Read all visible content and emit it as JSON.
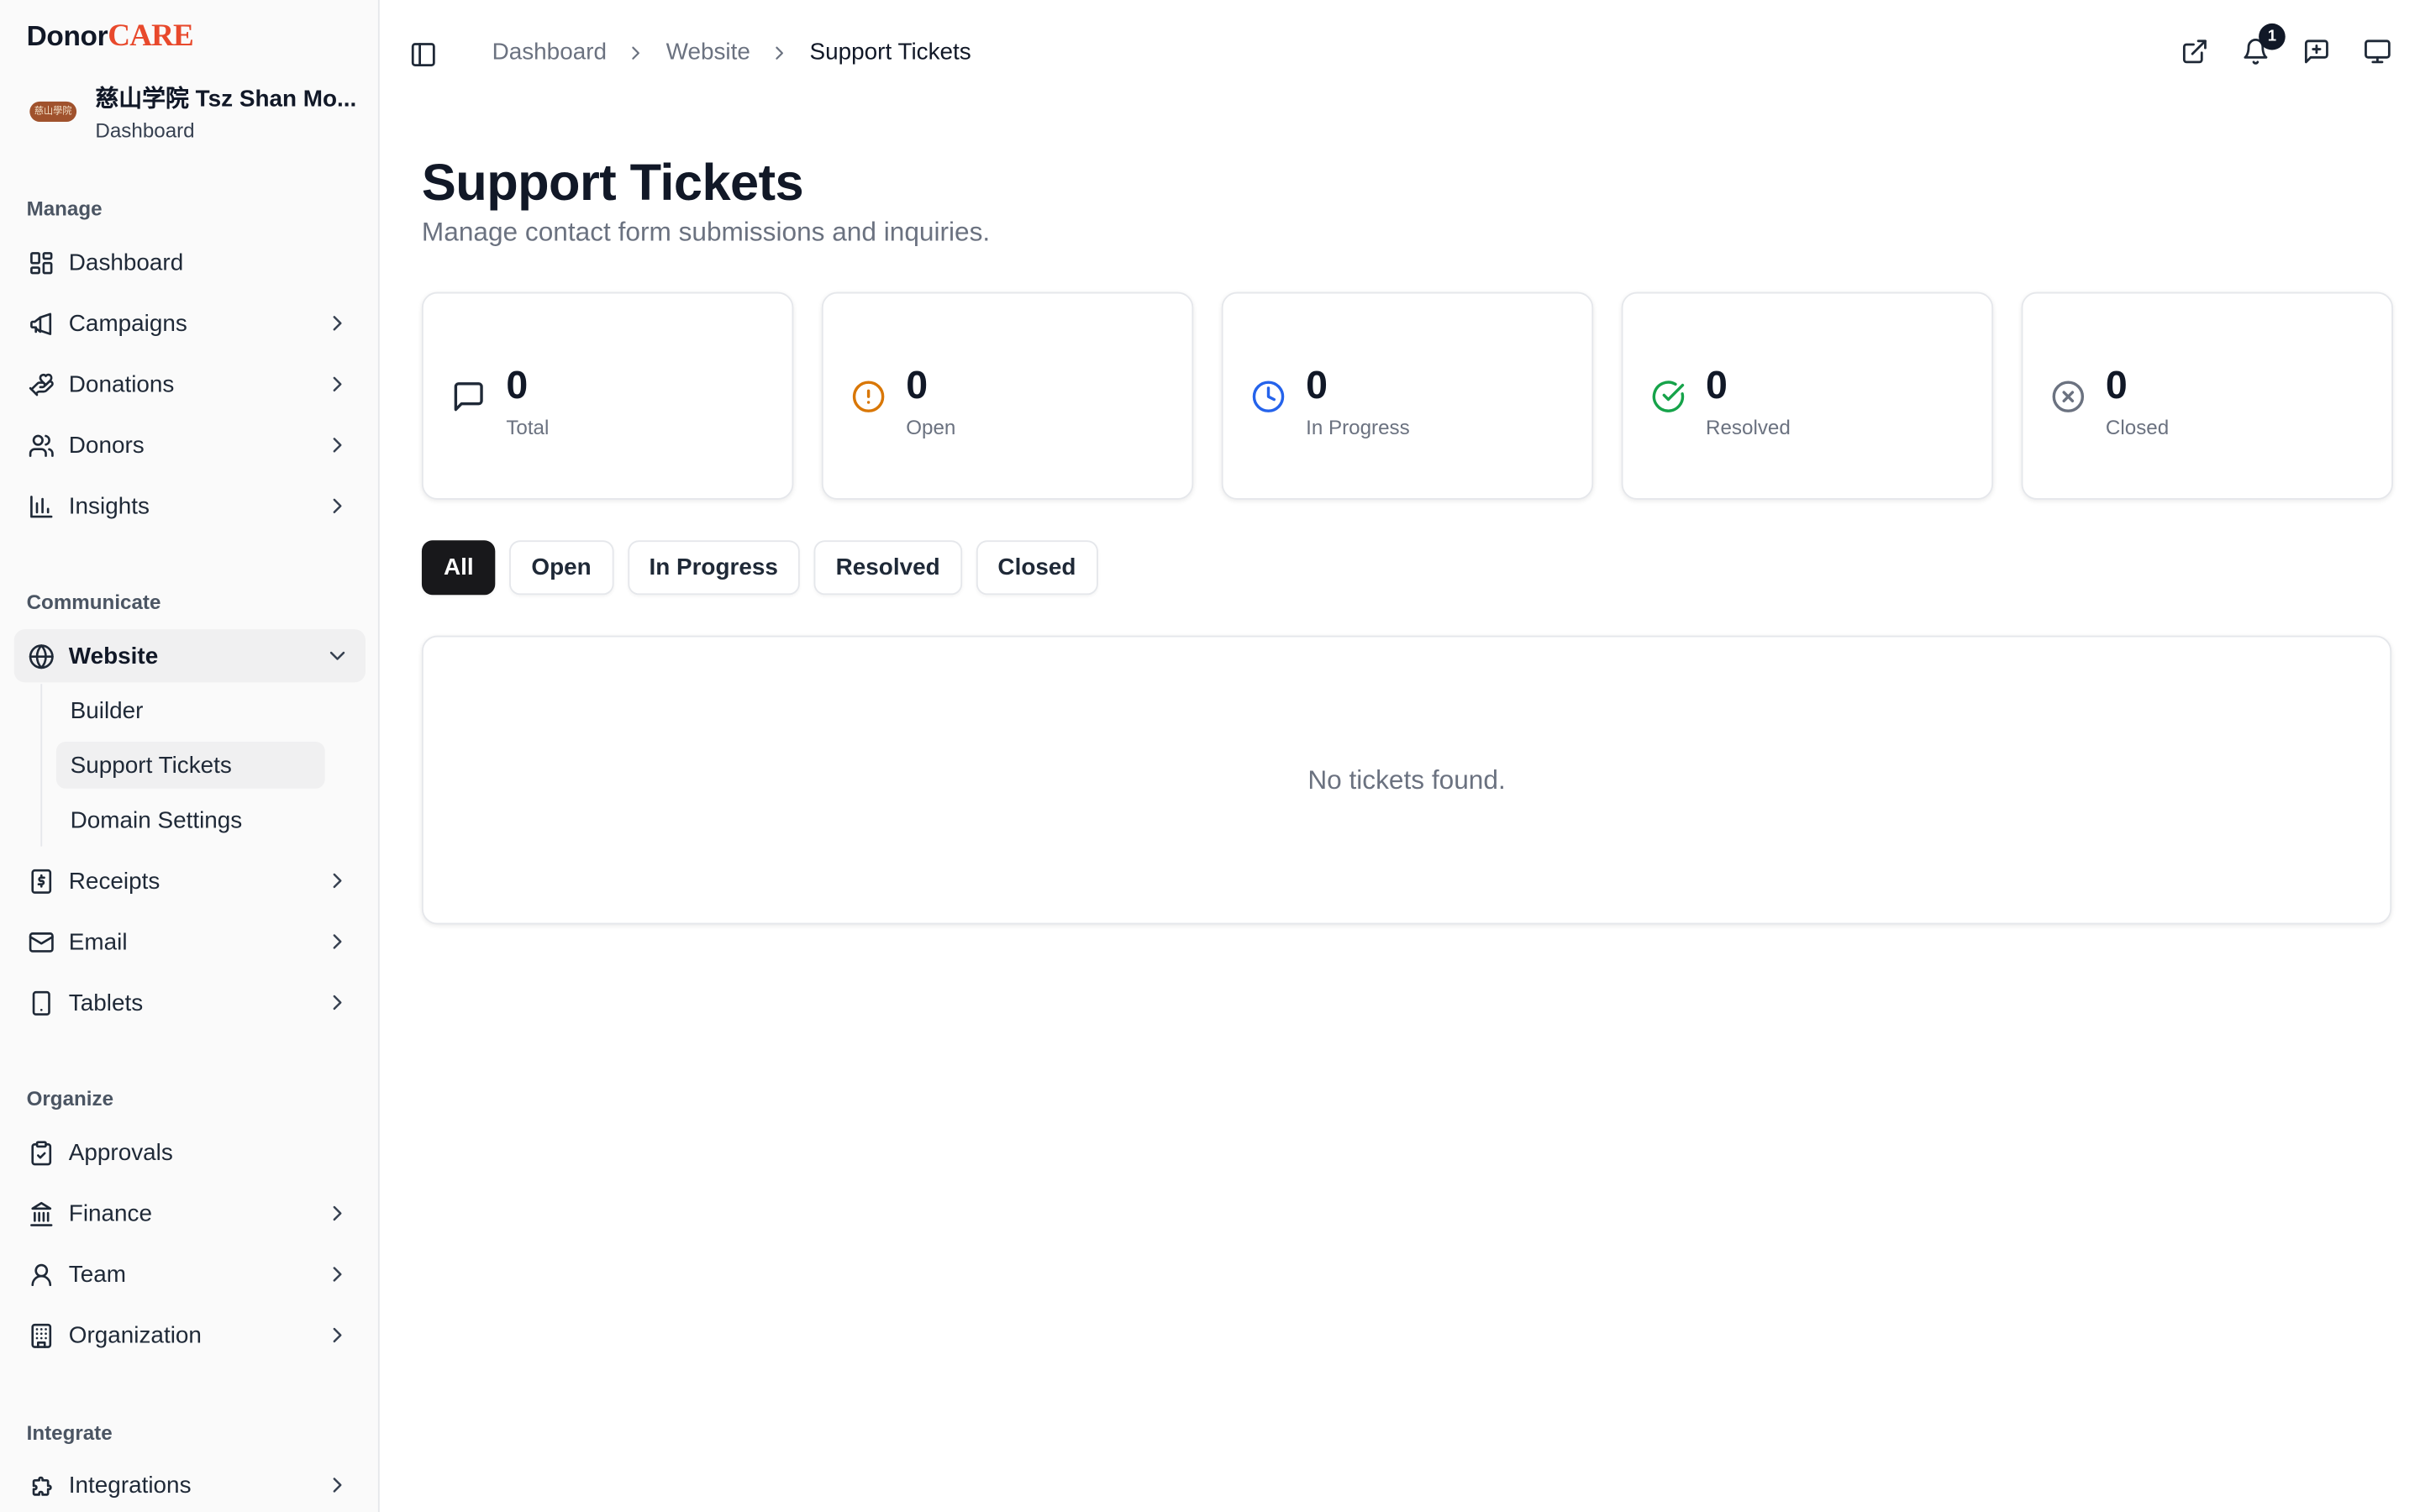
{
  "brand": {
    "part1": "Donor",
    "part2": "CARE"
  },
  "org": {
    "name": "慈山学院 Tsz Shan Mo...",
    "subtitle": "Dashboard",
    "avatar_text": "慈山學院"
  },
  "sidebar": {
    "sections": [
      "Manage",
      "Communicate",
      "Organize",
      "Integrate"
    ],
    "items": [
      {
        "label": "Dashboard",
        "icon": "layout-grid-icon"
      },
      {
        "label": "Campaigns",
        "icon": "megaphone-icon"
      },
      {
        "label": "Donations",
        "icon": "hand-heart-icon"
      },
      {
        "label": "Donors",
        "icon": "users-icon"
      },
      {
        "label": "Insights",
        "icon": "bar-chart-icon"
      },
      {
        "label": "Website",
        "icon": "globe-icon"
      },
      {
        "label": "Receipts",
        "icon": "receipt-dollar-icon"
      },
      {
        "label": "Email",
        "icon": "mail-icon"
      },
      {
        "label": "Tablets",
        "icon": "tablet-icon"
      },
      {
        "label": "Approvals",
        "icon": "clipboard-check-icon"
      },
      {
        "label": "Finance",
        "icon": "landmark-icon"
      },
      {
        "label": "Team",
        "icon": "user-icon"
      },
      {
        "label": "Organization",
        "icon": "building-icon"
      },
      {
        "label": "Integrations",
        "icon": "puzzle-icon"
      }
    ],
    "website_sub": [
      "Builder",
      "Support Tickets",
      "Domain Settings"
    ]
  },
  "breadcrumb": [
    "Dashboard",
    "Website",
    "Support Tickets"
  ],
  "header": {
    "notification_count": "1"
  },
  "page": {
    "title": "Support Tickets",
    "subtitle": "Manage contact form submissions and inquiries."
  },
  "stats": [
    {
      "value": "0",
      "label": "Total",
      "icon": "message-square-icon",
      "color": "#1f2937"
    },
    {
      "value": "0",
      "label": "Open",
      "icon": "alert-circle-icon",
      "color": "#d97706"
    },
    {
      "value": "0",
      "label": "In Progress",
      "icon": "clock-icon",
      "color": "#2563eb"
    },
    {
      "value": "0",
      "label": "Resolved",
      "icon": "check-circle-icon",
      "color": "#16a34a"
    },
    {
      "value": "0",
      "label": "Closed",
      "icon": "x-circle-icon",
      "color": "#6b7280"
    }
  ],
  "filters": [
    "All",
    "Open",
    "In Progress",
    "Resolved",
    "Closed"
  ],
  "active_filter": "All",
  "empty_message": "No tickets found."
}
